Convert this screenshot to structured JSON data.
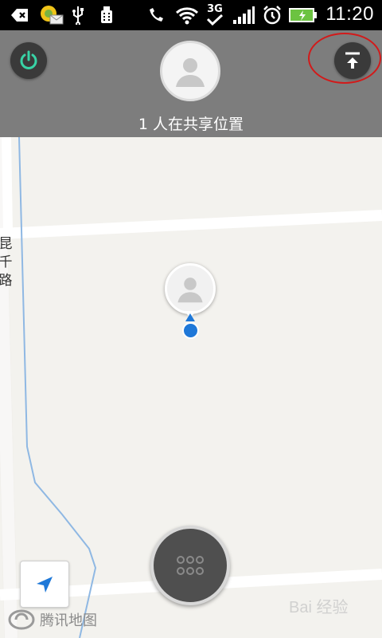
{
  "status_bar": {
    "time": "11:20",
    "network": "3G",
    "icons": [
      "back-icon",
      "app-icon",
      "usb-icon",
      "android-debug-icon",
      "phone-icon",
      "wifi-icon",
      "3g-icon",
      "signal-icon",
      "alarm-icon",
      "battery-icon"
    ]
  },
  "header": {
    "share_count_text": "1 人在共享位置",
    "power_icon": "power-icon",
    "upload_icon": "upload-to-top-icon",
    "highlight_color": "#d21a1a"
  },
  "map": {
    "road_label": "昆千路",
    "brand_name": "腾讯地图",
    "watermark": "Bai 经验",
    "location_color": "#1e78d8"
  },
  "controls": {
    "locate_icon": "navigation-arrow-icon",
    "menu_icon": "grid-dots-icon"
  }
}
